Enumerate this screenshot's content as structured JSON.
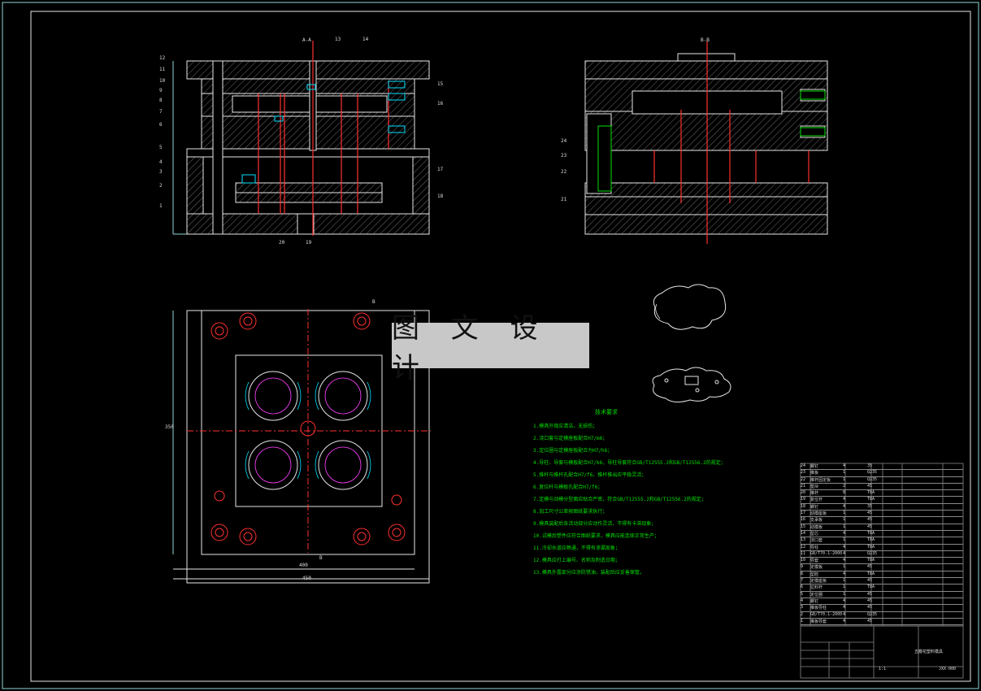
{
  "watermark": "图 文 设 计",
  "section_labels": {
    "left": "A-A",
    "right": "B-B",
    "plan_cut_top": "B",
    "plan_cut_bottom": "B"
  },
  "dimensions": {
    "inner_width": "400",
    "outer_width": "450",
    "height": "350"
  },
  "part_callouts_left": [
    "12",
    "11",
    "10",
    "9",
    "8",
    "7",
    "6",
    "5",
    "4",
    "3",
    "2",
    "1"
  ],
  "part_callouts_top": [
    "13",
    "14"
  ],
  "part_callouts_right": [
    "15",
    "16",
    "17",
    "18"
  ],
  "part_callouts_bottom": [
    "20",
    "19"
  ],
  "part_callouts_right_view": [
    "24",
    "23",
    "22",
    "21"
  ],
  "tech_notes": {
    "title": "技术要求",
    "lines": [
      "1.模具外观应清洁，无损伤；",
      "2.浇口套与定模座板配合H7/m6；",
      "3.定位圈与定模座板配合为H7/h6；",
      "4.导柱、导套与模板配合H7/k6，导柱导套符合GB/T12555.2和GB/T12556.2的规定；",
      "5.推杆与推杆孔配合H7/f6，推杆推出应平稳灵活；",
      "6.复位杆与模板孔配合H7/f6；",
      "7.定模与动模分型面应贴合严密，符合GB/T12555.2和GB/T12556.2的规定；",
      "8.加工尺寸公差按图纸要求执行；",
      "9.模具装配后各活动部分应动作灵活，不得有卡滞现象；",
      "10.试模后塑件应符合图纸要求，模具应能连续正常生产；",
      "11.冷却水道应畅通，不得有渗漏现象；",
      "12.模具应打上编号、名称及制造日期；",
      "13.模具外露部分应涂防锈油，装配后应妥善保管。"
    ]
  },
  "parts_table": {
    "rows": [
      [
        "24",
        "螺钉",
        "4",
        "35",
        ""
      ],
      [
        "23",
        "推板",
        "1",
        "Q235",
        ""
      ],
      [
        "22",
        "推杆固定板",
        "1",
        "Q235",
        ""
      ],
      [
        "21",
        "垫块",
        "2",
        "45",
        ""
      ],
      [
        "20",
        "推杆",
        "8",
        "T8A",
        ""
      ],
      [
        "19",
        "复位杆",
        "4",
        "T8A",
        ""
      ],
      [
        "18",
        "螺钉",
        "4",
        "35",
        ""
      ],
      [
        "17",
        "动模座板",
        "1",
        "45",
        ""
      ],
      [
        "16",
        "支承板",
        "1",
        "45",
        ""
      ],
      [
        "15",
        "动模板",
        "1",
        "45",
        ""
      ],
      [
        "14",
        "型芯",
        "4",
        "T8A",
        ""
      ],
      [
        "13",
        "浇口套",
        "1",
        "T8A",
        ""
      ],
      [
        "12",
        "导柱",
        "4",
        "T8A",
        ""
      ],
      [
        "11",
        "GB/T70.1-2000",
        "4",
        "Q235",
        ""
      ],
      [
        "10",
        "导套",
        "4",
        "T8A",
        ""
      ],
      [
        "9",
        "定模板",
        "1",
        "45",
        ""
      ],
      [
        "8",
        "型腔",
        "4",
        "T8A",
        ""
      ],
      [
        "7",
        "定模座板",
        "1",
        "45",
        ""
      ],
      [
        "6",
        "拉料杆",
        "1",
        "T8A",
        ""
      ],
      [
        "5",
        "定位圈",
        "1",
        "45",
        ""
      ],
      [
        "4",
        "螺钉",
        "4",
        "45",
        ""
      ],
      [
        "3",
        "推板导柱",
        "4",
        "45",
        ""
      ],
      [
        "2",
        "GB/T70.1-2000",
        "4",
        "Q235",
        ""
      ],
      [
        "1",
        "推板导套",
        "4",
        "45",
        ""
      ]
    ]
  },
  "title_block": {
    "name": "五瓣花塑料模具",
    "code": "JXX-000",
    "scale": "1:1"
  },
  "colors": {
    "line_white": "#e6e6e6",
    "red": "#ff3030",
    "cyan": "#00e0ff",
    "green": "#00e000",
    "magenta": "#ff40ff"
  }
}
